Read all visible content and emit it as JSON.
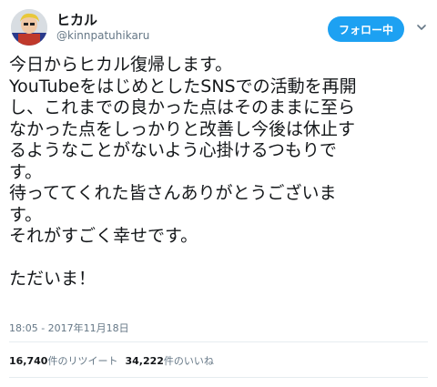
{
  "user": {
    "display_name": "ヒカル",
    "username": "@kinnpatuhikaru"
  },
  "header": {
    "follow_button": "フォロー中",
    "caret_icon": "chevron-down-icon"
  },
  "tweet": {
    "lines": [
      "今日からヒカル復帰します。",
      "YouTubeをはじめとしたSNSでの活動を再開",
      "し、これまでの良かった点はそのままに至ら",
      "なかった点をしっかりと改善し今後は休止す",
      "るようなことがないよう心掛けるつもりで",
      "す。",
      "待っててくれた皆さんありがとうございま",
      "す。",
      "それがすごく幸せです。",
      "",
      "ただいま！"
    ],
    "timestamp": "18:05 - 2017年11月18日"
  },
  "stats": {
    "retweet_count": "16,740",
    "retweet_label": "件のリツイート",
    "like_count": "34,222",
    "like_label": "件のいいね"
  },
  "colors": {
    "accent": "#1da1f2",
    "text": "#14171a",
    "secondary": "#657786"
  }
}
